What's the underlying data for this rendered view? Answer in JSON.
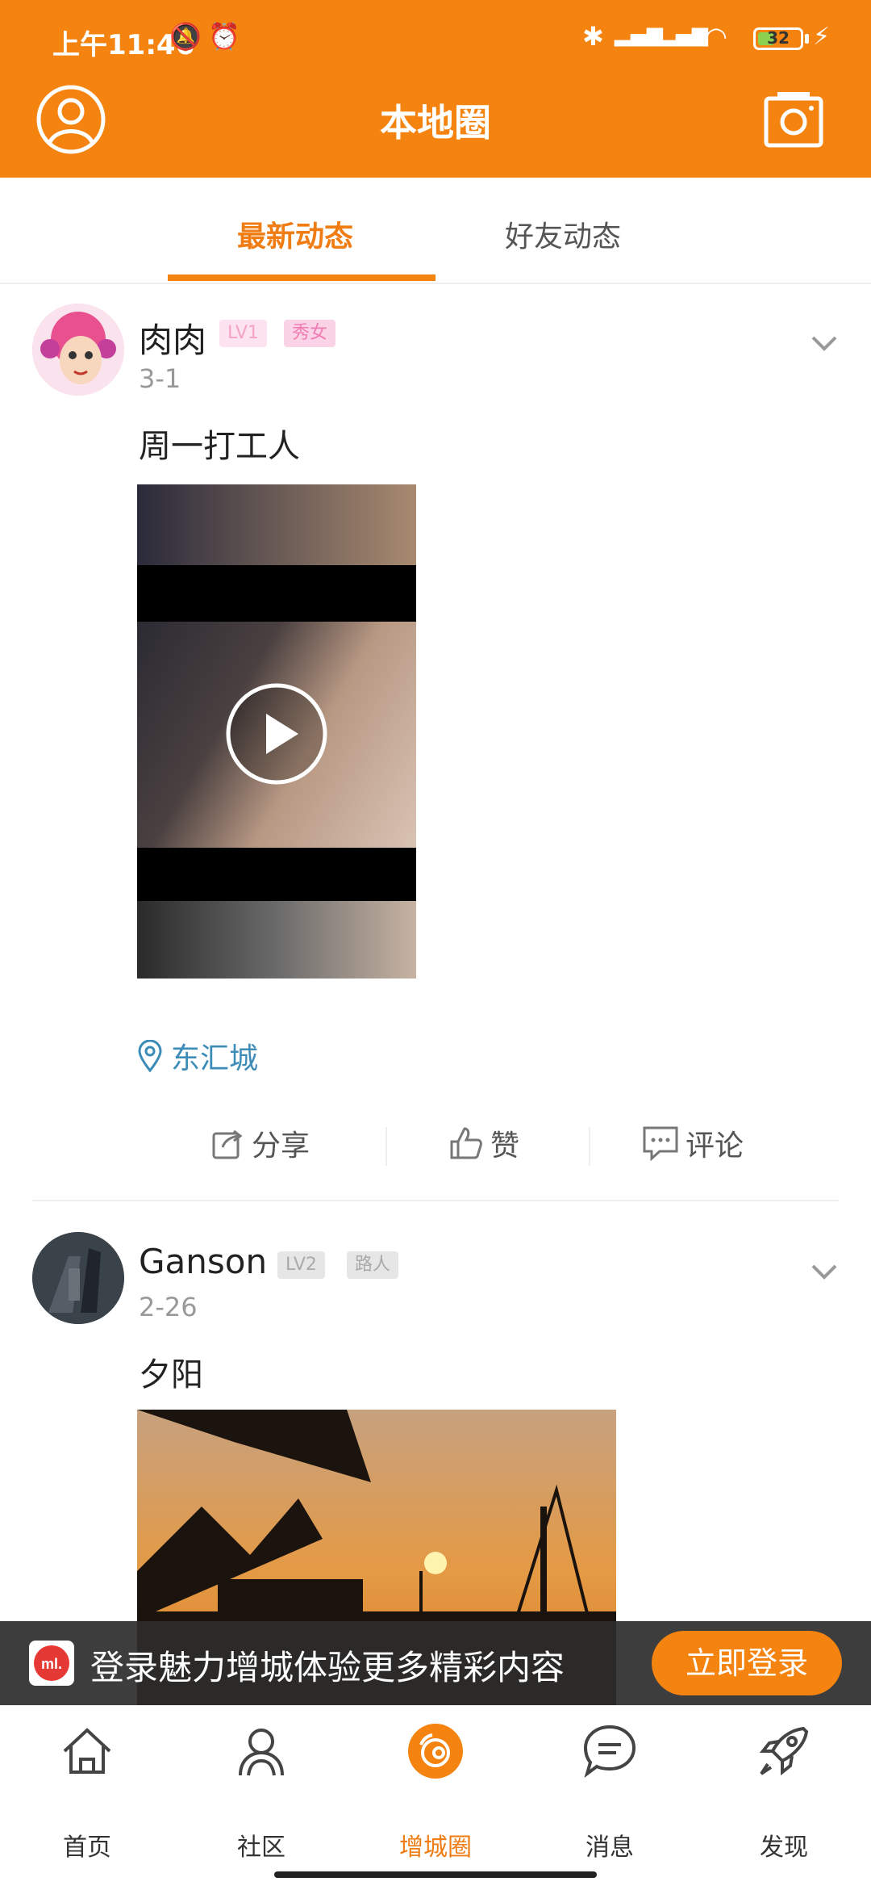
{
  "status": {
    "time": "上午11:46",
    "battery": "32"
  },
  "header": {
    "title": "本地圈"
  },
  "tabs": [
    {
      "label": "最新动态",
      "active": true
    },
    {
      "label": "好友动态",
      "active": false
    }
  ],
  "posts": [
    {
      "name": "肉肉",
      "level": "LV1",
      "tag": "秀女",
      "date": "3-1",
      "text": "周一打工人",
      "media": "video",
      "location": "东汇城",
      "actions": {
        "share": "分享",
        "like": "赞",
        "comment": "评论"
      }
    },
    {
      "name": "Ganson",
      "level": "LV2",
      "tag": "路人",
      "date": "2-26",
      "text": "夕阳",
      "media": "image"
    }
  ],
  "login_banner": {
    "text": "登录魅力增城体验更多精彩内容",
    "button": "立即登录",
    "logo": "ml."
  },
  "nav": [
    {
      "label": "首页",
      "icon": "home-icon",
      "active": false
    },
    {
      "label": "社区",
      "icon": "community-icon",
      "active": false
    },
    {
      "label": "增城圈",
      "icon": "circle-icon",
      "active": true
    },
    {
      "label": "消息",
      "icon": "message-icon",
      "active": false
    },
    {
      "label": "发现",
      "icon": "rocket-icon",
      "active": false
    }
  ],
  "colors": {
    "brand": "#f5830f",
    "link": "#3d8cb8"
  }
}
